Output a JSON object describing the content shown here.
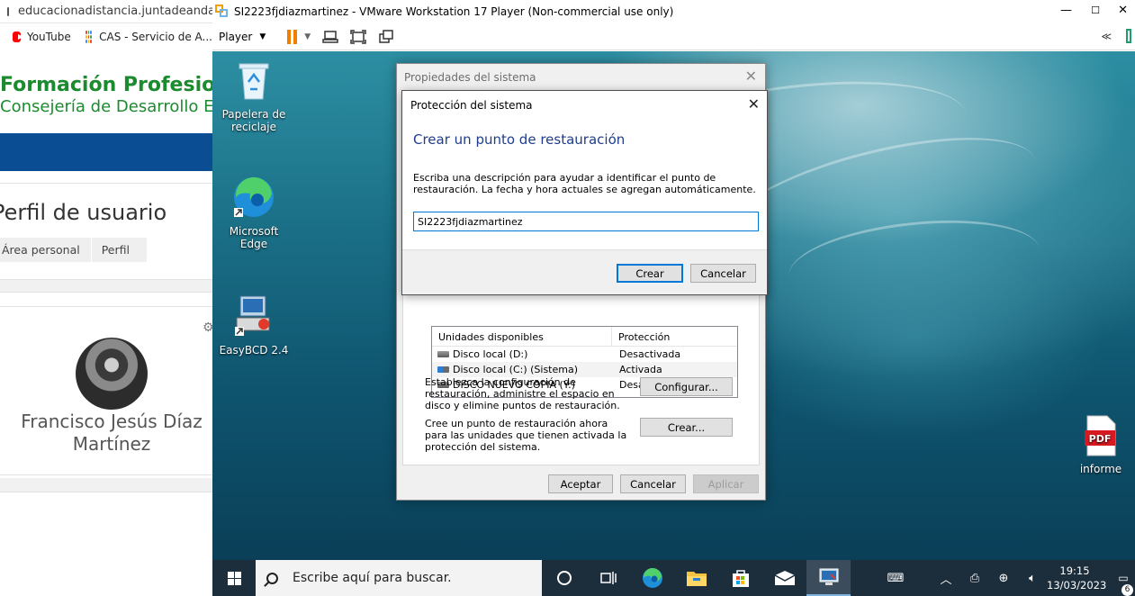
{
  "browser": {
    "url": "educacionadistancia.juntadeandalucia.es",
    "bookmarks": [
      {
        "label": "YouTube",
        "icon": "youtube-icon"
      },
      {
        "label": "CAS - Servicio de A...",
        "icon": "cas-icon"
      }
    ],
    "site_title": "Formación Profesional",
    "site_subtitle": "Consejería de Desarrollo Educativo",
    "page_heading": "Perfil de usuario",
    "breadcrumbs": [
      "Área personal",
      "Perfil"
    ],
    "user_name": "Francisco Jesús Díaz Martínez",
    "colors": {
      "brand_green": "#1c8a2e",
      "banner_blue": "#0a4d92"
    }
  },
  "vmware": {
    "title": "SI2223fjdiazmartinez - VMware Workstation 17 Player (Non-commercial use only)",
    "player_menu": "Player",
    "controls": {
      "minimize": "—",
      "maximize": "☐",
      "close": "✕"
    },
    "toolbar_right": "≪",
    "accent_pause": "#f07f00"
  },
  "desktop": {
    "icons": [
      {
        "label": "Papelera de reciclaje",
        "icon": "recycle-bin-icon"
      },
      {
        "label": "Microsoft Edge",
        "icon": "edge-icon"
      },
      {
        "label": "EasyBCD 2.4",
        "icon": "easybcd-icon"
      },
      {
        "label": "informe",
        "icon": "pdf-icon",
        "badge": "PDF"
      }
    ]
  },
  "system_properties": {
    "title": "Propiedades del sistema",
    "table": {
      "headers": [
        "Unidades disponibles",
        "Protección"
      ],
      "rows": [
        {
          "drive": "Disco local (D:)",
          "protection": "Desactivada"
        },
        {
          "drive": "Disco local (C:) (Sistema)",
          "protection": "Activada"
        },
        {
          "drive": "DISCO NUEVO COPIA (Y:)",
          "protection": "Desactivada"
        }
      ]
    },
    "configure_text": "Establezca la configuración de restauración, administre el espacio en disco y elimine puntos de restauración.",
    "configure_button": "Configurar...",
    "create_text": "Cree un punto de restauración ahora para las unidades que tienen activada la protección del sistema.",
    "create_button": "Crear...",
    "ok_button": "Aceptar",
    "cancel_button": "Cancelar",
    "apply_button": "Aplicar"
  },
  "restore_dialog": {
    "title": "Protección del sistema",
    "heading": "Crear un punto de restauración",
    "description": "Escriba una descripción para ayudar a identificar el punto de restauración. La fecha y hora actuales se agregan automáticamente.",
    "input_value": "SI2223fjdiazmartinez",
    "create_button": "Crear",
    "cancel_button": "Cancelar",
    "heading_color": "#1e3d8c"
  },
  "taskbar": {
    "search_placeholder": "Escribe aquí para buscar.",
    "time": "19:15",
    "date": "13/03/2023",
    "notification_count": "6"
  }
}
